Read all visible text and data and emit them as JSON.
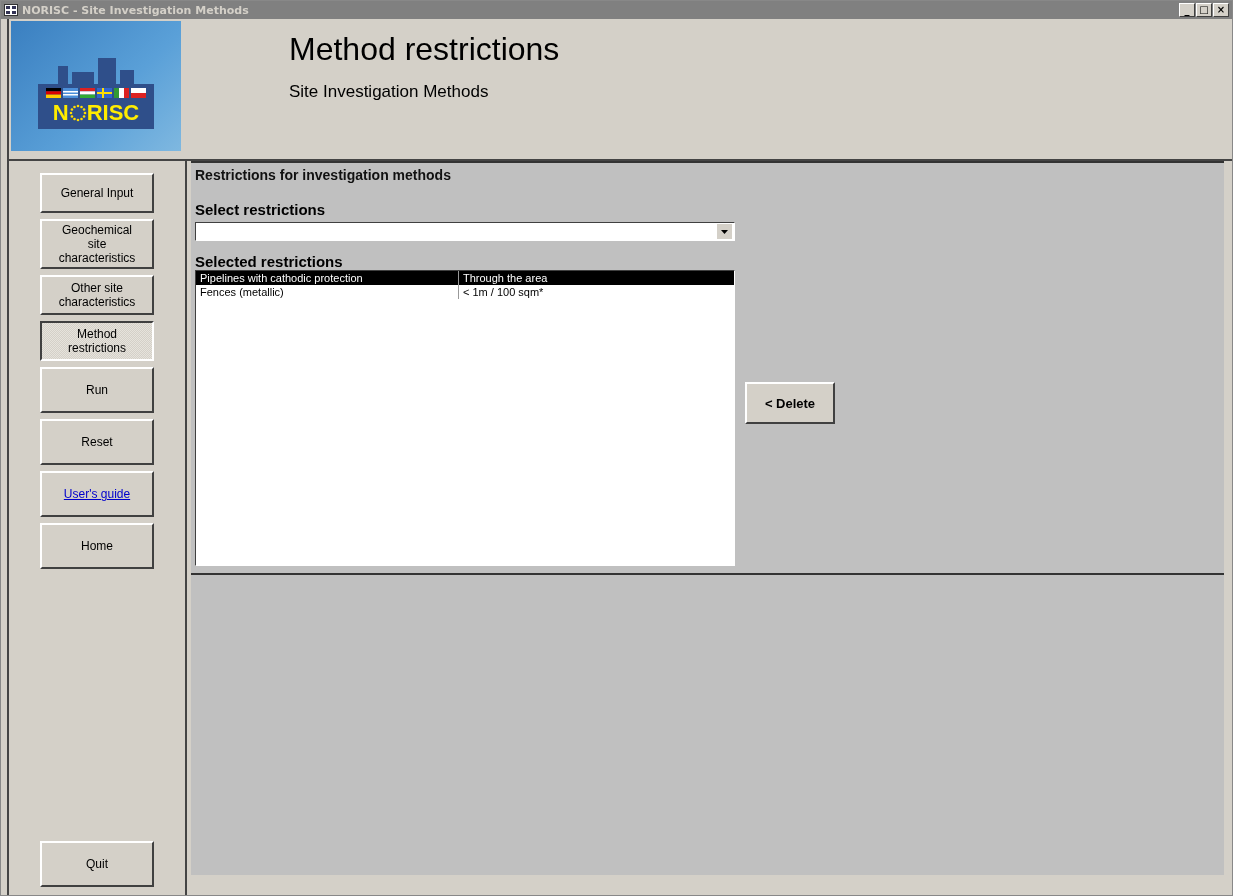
{
  "window": {
    "title": "NORISC - Site Investigation Methods",
    "controls": [
      "_",
      "□",
      "×"
    ]
  },
  "logo": {
    "text_left": "N",
    "text_right": "RISC"
  },
  "header": {
    "title": "Method restrictions",
    "subtitle": "Site Investigation Methods"
  },
  "nav": [
    {
      "label": "General Input",
      "kind": "button",
      "selected": false
    },
    {
      "label": "Geochemical site characteristics",
      "kind": "button",
      "selected": false
    },
    {
      "label": "Other site characteristics",
      "kind": "button",
      "selected": false
    },
    {
      "label": "Method restrictions",
      "kind": "button",
      "selected": true
    },
    {
      "label": "Run",
      "kind": "button",
      "selected": false
    },
    {
      "label": "Reset",
      "kind": "button",
      "selected": false
    },
    {
      "label": "User's guide",
      "kind": "link",
      "selected": false
    },
    {
      "label": "Home",
      "kind": "button",
      "selected": false
    }
  ],
  "quit": {
    "label": "Quit"
  },
  "panel": {
    "title": "Restrictions for investigation methods",
    "select_label": "Select restrictions",
    "list_label": "Selected restrictions",
    "rows": [
      {
        "name": "Pipelines with cathodic protection",
        "value": "Through the area",
        "selected": true
      },
      {
        "name": "Fences (metallic)",
        "value": "< 1m / 100 sqm*",
        "selected": false
      }
    ],
    "delete": "< Delete"
  }
}
